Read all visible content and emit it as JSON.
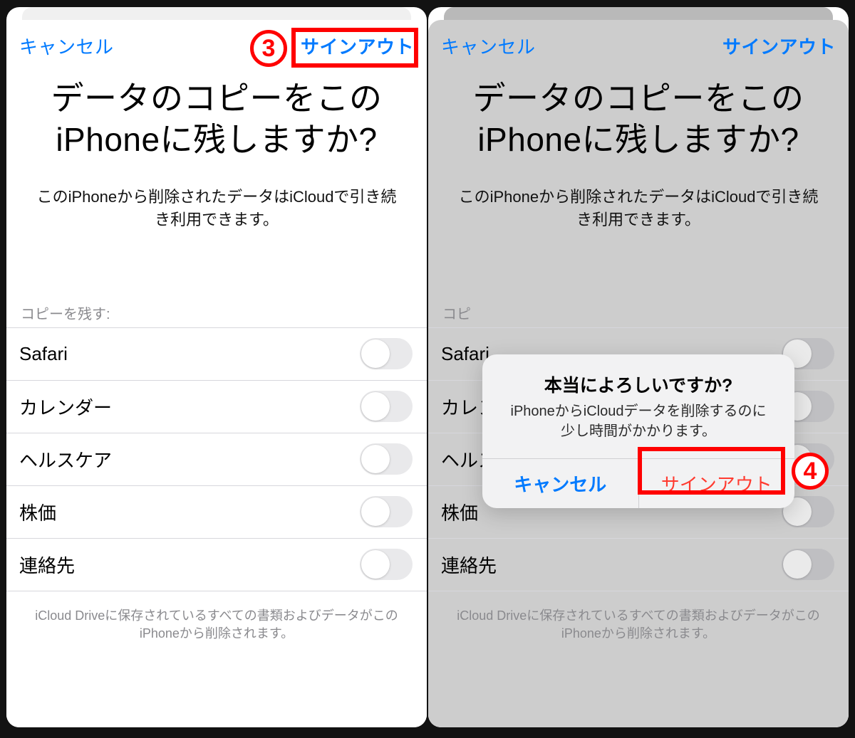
{
  "nav": {
    "cancel": "キャンセル",
    "signout": "サインアウト"
  },
  "heading": "データのコピーをこのiPhoneに残しますか?",
  "subheading": "このiPhoneから削除されたデータはiCloudで引き続き利用できます。",
  "section_label": "コピーを残す:",
  "items": [
    {
      "label": "Safari"
    },
    {
      "label": "カレンダー"
    },
    {
      "label": "ヘルスケア"
    },
    {
      "label": "株価"
    },
    {
      "label": "連絡先"
    }
  ],
  "footer": "iCloud Driveに保存されているすべての書類およびデータがこのiPhoneから削除されます。",
  "alert": {
    "title": "本当によろしいですか?",
    "message": "iPhoneからiCloudデータを削除するのに少し時間がかかります。",
    "cancel": "キャンセル",
    "confirm": "サインアウト"
  },
  "steps": {
    "three": "3",
    "four": "4"
  },
  "section_label_truncated": "コピ"
}
